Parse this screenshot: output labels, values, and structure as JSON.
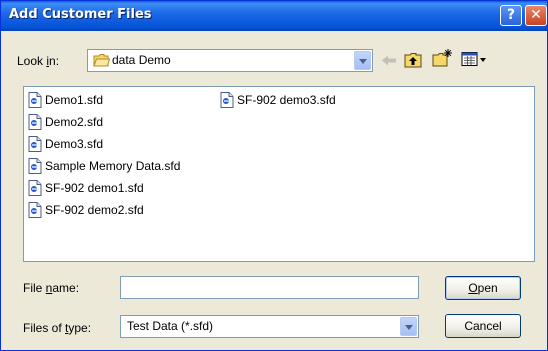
{
  "window": {
    "title": "Add Customer Files",
    "help_glyph": "?",
    "close_glyph": "✕"
  },
  "look_in": {
    "label_prefix": "Look ",
    "label_accel": "i",
    "label_suffix": "n:",
    "value": "data Demo"
  },
  "toolbar": {
    "back_icon": "back-arrow-icon",
    "up_icon": "up-one-level-icon",
    "new_folder_icon": "new-folder-icon",
    "view_menu_icon": "view-menu-icon"
  },
  "files": [
    {
      "name": "Demo1.sfd"
    },
    {
      "name": "Demo2.sfd"
    },
    {
      "name": "Demo3.sfd"
    },
    {
      "name": "Sample Memory Data.sfd"
    },
    {
      "name": "SF-902 demo1.sfd"
    },
    {
      "name": "SF-902 demo2.sfd"
    },
    {
      "name": "SF-902 demo3.sfd"
    }
  ],
  "file_name": {
    "label_prefix": "File ",
    "label_accel": "n",
    "label_suffix": "ame:",
    "value": ""
  },
  "file_type": {
    "label_prefix": "Files of ",
    "label_accel": "t",
    "label_suffix": "ype:",
    "value": "Test Data (*.sfd)"
  },
  "buttons": {
    "open_accel": "O",
    "open_rest": "pen",
    "cancel": "Cancel"
  },
  "colors": {
    "titlebar": "#0553d6",
    "dialog_bg": "#ece9d8",
    "field_border": "#7f9db9"
  }
}
